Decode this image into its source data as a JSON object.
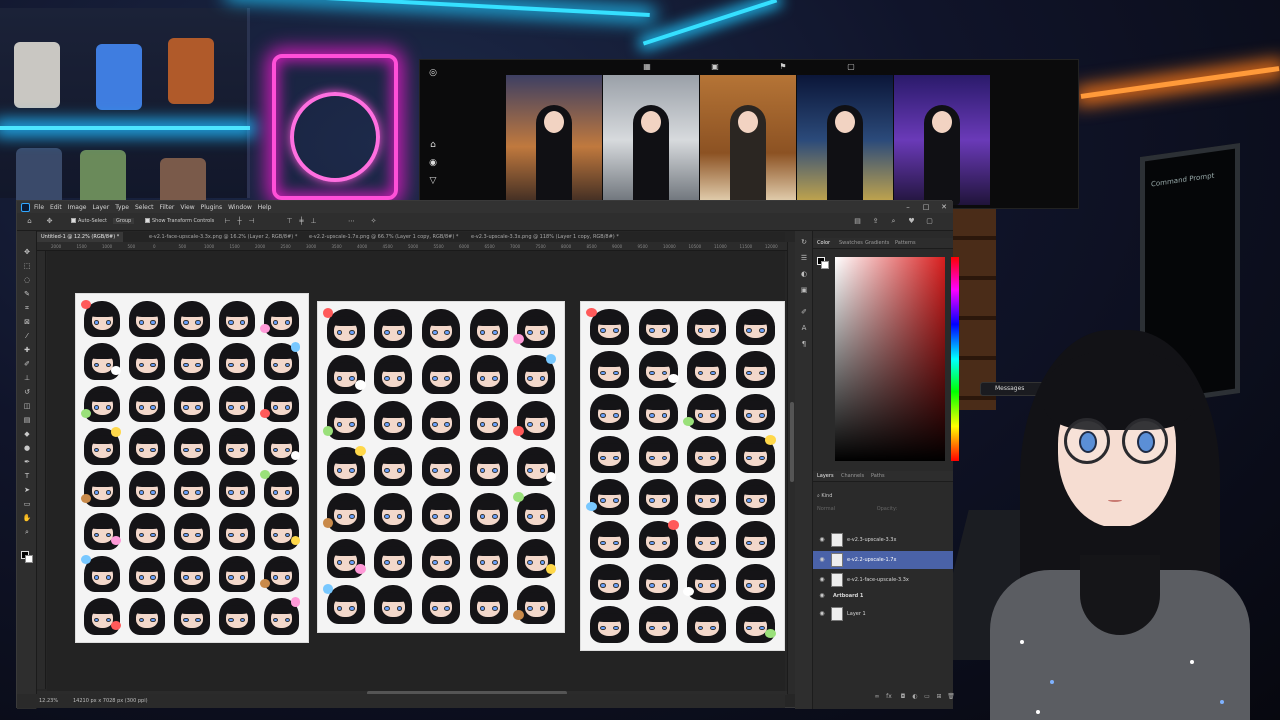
{
  "photoshop": {
    "menu": [
      "File",
      "Edit",
      "Image",
      "Layer",
      "Type",
      "Select",
      "Filter",
      "View",
      "Plugins",
      "Window",
      "Help"
    ],
    "options_bar": {
      "auto_select_label": "Auto-Select",
      "group_label": "Group",
      "show_transform_label": "Show Transform Controls"
    },
    "doc_tabs": [
      "Untitled-1 @ 12.2% (RGB/8#) *",
      "e-v2.1-face-upscale-3.3x.png @ 16.2% (Layer 2, RGB/8#) *",
      "e-v2.2-upscale-1.7x.png @ 66.7% (Layer 1 copy, RGB/8#) *",
      "e-v2.3-upscale-3.3x.png @ 118% (Layer 1 copy, RGB/8#) *"
    ],
    "ruler_ticks": [
      "2000",
      "1500",
      "1000",
      "500",
      "0",
      "500",
      "1000",
      "1500",
      "2000",
      "2500",
      "3000",
      "3500",
      "4000",
      "4500",
      "5000",
      "5500",
      "6000",
      "6500",
      "7000",
      "7500",
      "8000",
      "8500",
      "9000",
      "9500",
      "10000",
      "10500",
      "11000",
      "11500",
      "12000"
    ],
    "status": {
      "zoom": "12.23%",
      "doc_info": "14210 px x 7028 px (300 ppi)"
    },
    "color_panel": {
      "tabs": [
        "Color",
        "Swatches",
        "Gradients",
        "Patterns"
      ],
      "base_hue": "#d81e1e"
    },
    "layers_panel": {
      "tabs": [
        "Layers",
        "Channels",
        "Paths"
      ],
      "search_label": "Kind",
      "blend_mode": "Normal",
      "opacity_label": "Opacity:",
      "layers": [
        {
          "name": "e-v2.3-upscale-3.3x",
          "selected": false
        },
        {
          "name": "e-v2.2-upscale-1.7x",
          "selected": true
        },
        {
          "name": "e-v2.1-face-upscale-3.3x",
          "selected": false
        },
        {
          "name": "Artboard 1",
          "selected": false,
          "group": true
        },
        {
          "name": "Layer 1",
          "selected": false
        }
      ]
    }
  },
  "overlay": {
    "messages_label": "Messages",
    "terminal_title": "Command Prompt"
  },
  "colors": {
    "ps_bg": "#262626",
    "accent_selected": "#4a62a8",
    "neon_pink": "#ff4fd8",
    "neon_cyan": "#35e0ff"
  }
}
